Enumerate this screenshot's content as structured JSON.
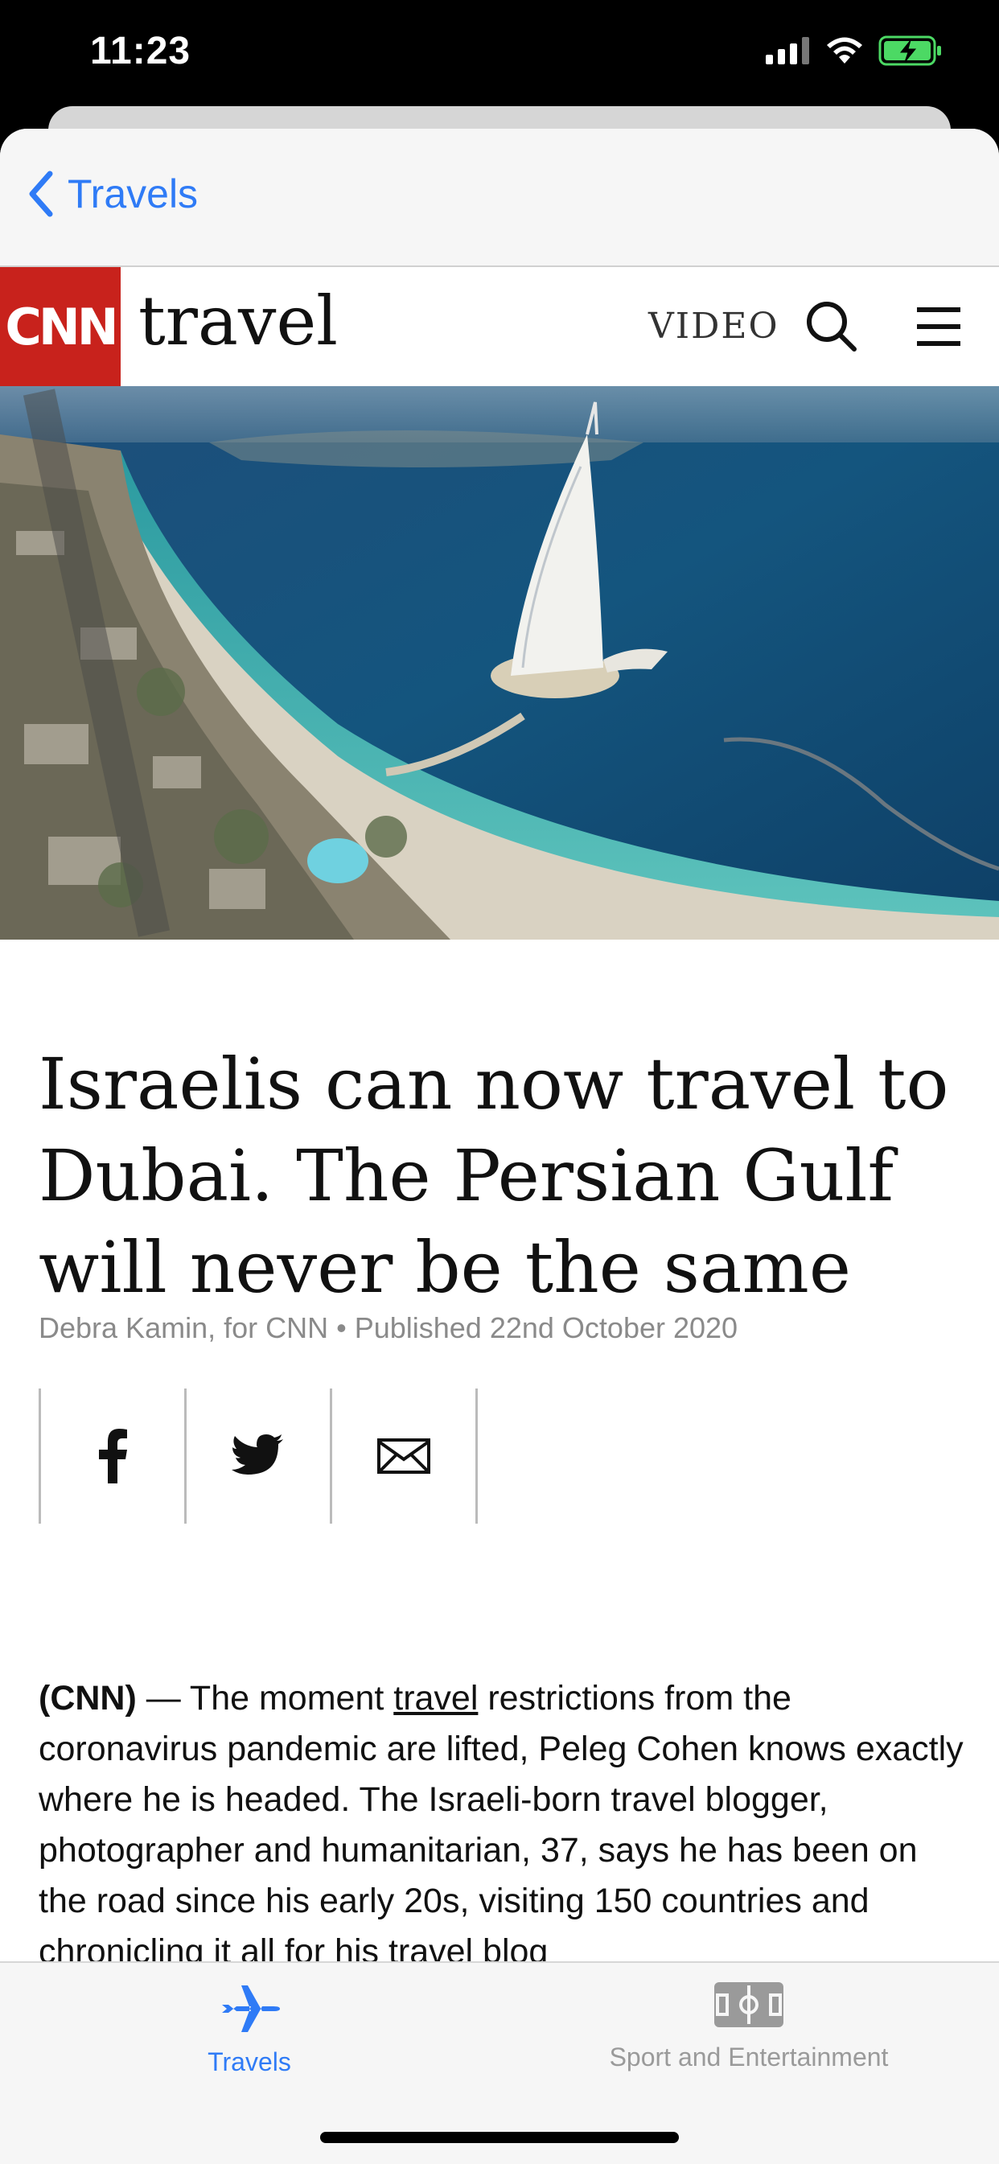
{
  "status_bar": {
    "time": "11:23"
  },
  "nav": {
    "back_label": "Travels"
  },
  "cnn": {
    "logo": "CNN",
    "brand": "travel",
    "video_label": "VIDEO",
    "search_icon": "search-icon",
    "menu_icon": "hamburger-menu-icon"
  },
  "hero": {
    "image_description": "aerial-photo-burj-al-arab-dubai-coast"
  },
  "article": {
    "headline": "Israelis can now travel to Dubai. The Persian Gulf will never be the same",
    "byline": "Debra Kamin, for CNN • Published 22nd October 2020",
    "share": [
      {
        "icon": "facebook-icon"
      },
      {
        "icon": "twitter-icon"
      },
      {
        "icon": "email-icon"
      }
    ],
    "body_lead": "(CNN)",
    "body_dash": " — The moment ",
    "body_link": "travel",
    "body_rest": " restrictions from the coronavirus pandemic are lifted, Peleg Cohen knows exactly where he is headed. The Israeli-born travel blogger, photographer and humanitarian, 37, says he has been on the road since his early 20s, visiting 150 countries and chronicling it all for his travel blog"
  },
  "tabbar": {
    "tabs": [
      {
        "label": "Travels",
        "icon": "airplane-icon",
        "active": true,
        "color": "#2f7bf6"
      },
      {
        "label": "Sport and Entertainment",
        "icon": "soccer-field-icon",
        "active": false,
        "color": "#9a9a9a"
      }
    ]
  }
}
